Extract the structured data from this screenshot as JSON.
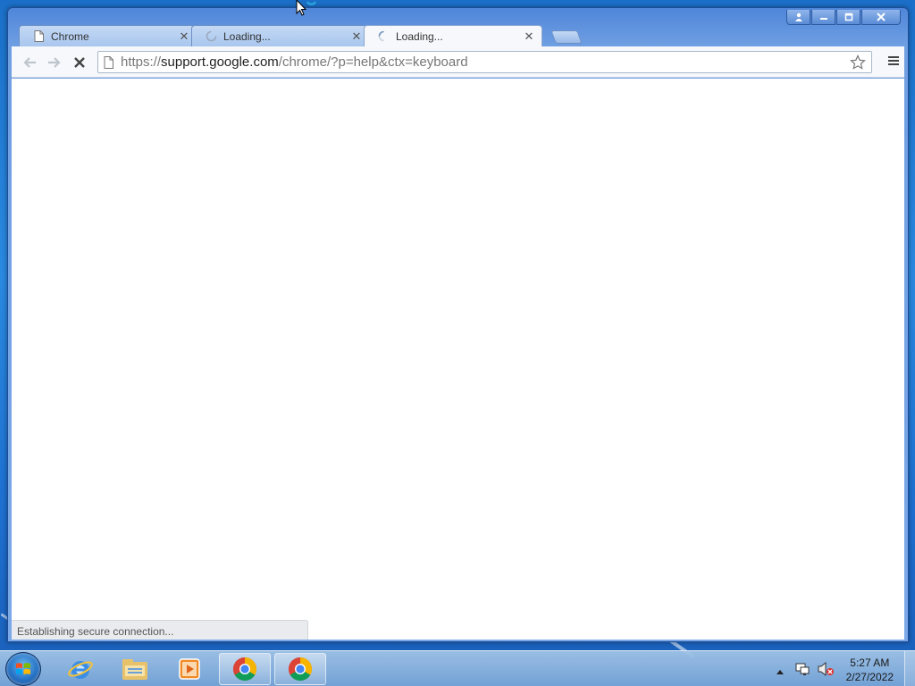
{
  "tabs": [
    {
      "title": "Chrome",
      "icon": "page-icon",
      "active": false
    },
    {
      "title": "Loading...",
      "icon": "spinner-icon",
      "active": false
    },
    {
      "title": "Loading...",
      "icon": "spinner-icon",
      "active": true
    }
  ],
  "omnibox": {
    "url_scheme": "https://",
    "url_host": "support.google.com",
    "url_path": "/chrome/?p=help&ctx=keyboard"
  },
  "status": {
    "text": "Establishing secure connection..."
  },
  "taskbar": {
    "items": [
      "internet-explorer-icon",
      "file-explorer-icon",
      "media-player-icon",
      "chrome-icon",
      "chrome-icon"
    ]
  },
  "clock": {
    "time": "5:27 AM",
    "date": "2/27/2022"
  },
  "colors": {
    "desktop": "#1e6fd0",
    "window_frame": "#6f9fe3",
    "toolbar": "#f6f8fb"
  }
}
